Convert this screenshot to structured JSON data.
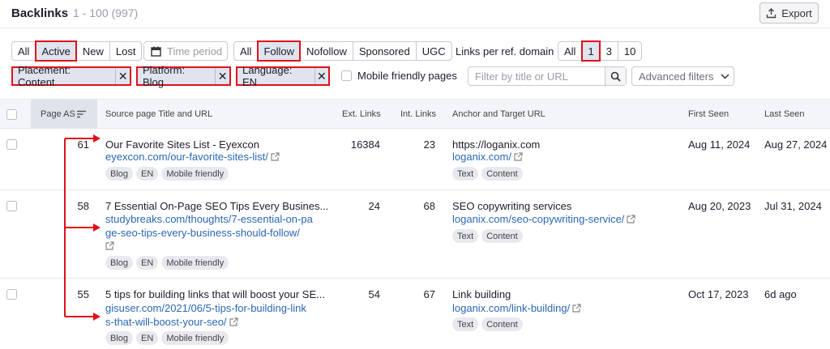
{
  "header": {
    "title": "Backlinks",
    "range": "1 - 100 (997)"
  },
  "export_label": "Export",
  "filters": {
    "status": [
      "All",
      "Active",
      "New",
      "Lost"
    ],
    "time_period": "Time period",
    "follow": [
      "All",
      "Follow",
      "Nofollow",
      "Sponsored",
      "UGC"
    ],
    "links_per_ref_label": "Links per ref. domain",
    "links_per_ref": [
      "All",
      "1",
      "3",
      "10"
    ],
    "chips": [
      "Placement: Content",
      "Platform: Blog",
      "Language: EN"
    ],
    "mobile_friendly": "Mobile friendly pages",
    "search_placeholder": "Filter by title or URL",
    "advanced": "Advanced filters"
  },
  "columns": {
    "page_as": "Page AS",
    "source": "Source page Title and URL",
    "ext": "Ext. Links",
    "int": "Int. Links",
    "anchor": "Anchor and Target URL",
    "first": "First Seen",
    "last": "Last Seen"
  },
  "rows": [
    {
      "as": "61",
      "title": "Our Favorite Sites List - Eyexcon",
      "url": [
        "eyexcon.com/our-favorite-sites-list/"
      ],
      "tags": [
        "Blog",
        "EN",
        "Mobile friendly"
      ],
      "ext": "16384",
      "int": "23",
      "anchor": "https://loganix.com",
      "target": "loganix.com/",
      "anchor_tags": [
        "Text",
        "Content"
      ],
      "first": "Aug 11, 2024",
      "last": "Aug 27, 2024"
    },
    {
      "as": "58",
      "title": "7 Essential On-Page SEO Tips Every Busines...",
      "url": [
        "studybreaks.com/thoughts/7-essential-on-pa",
        "ge-seo-tips-every-business-should-follow/"
      ],
      "tags": [
        "Blog",
        "EN",
        "Mobile friendly"
      ],
      "ext": "24",
      "int": "68",
      "anchor": "SEO copywriting services",
      "target": "loganix.com/seo-copywriting-service/",
      "anchor_tags": [
        "Text",
        "Content"
      ],
      "first": "Aug 20, 2023",
      "last": "Jul 31, 2024"
    },
    {
      "as": "55",
      "title": "5 tips for building links that will boost your SE...",
      "url": [
        "gisuser.com/2021/06/5-tips-for-building-link",
        "s-that-will-boost-your-seo/"
      ],
      "tags": [
        "Blog",
        "EN",
        "Mobile friendly"
      ],
      "ext": "54",
      "int": "67",
      "anchor": "Link building",
      "target": "loganix.com/link-building/",
      "anchor_tags": [
        "Text",
        "Content"
      ],
      "first": "Oct 17, 2023",
      "last": "6d ago"
    }
  ],
  "colors": {
    "highlight": "#e0101b",
    "link": "#2b67b5",
    "selected": "#dfe4ee"
  }
}
